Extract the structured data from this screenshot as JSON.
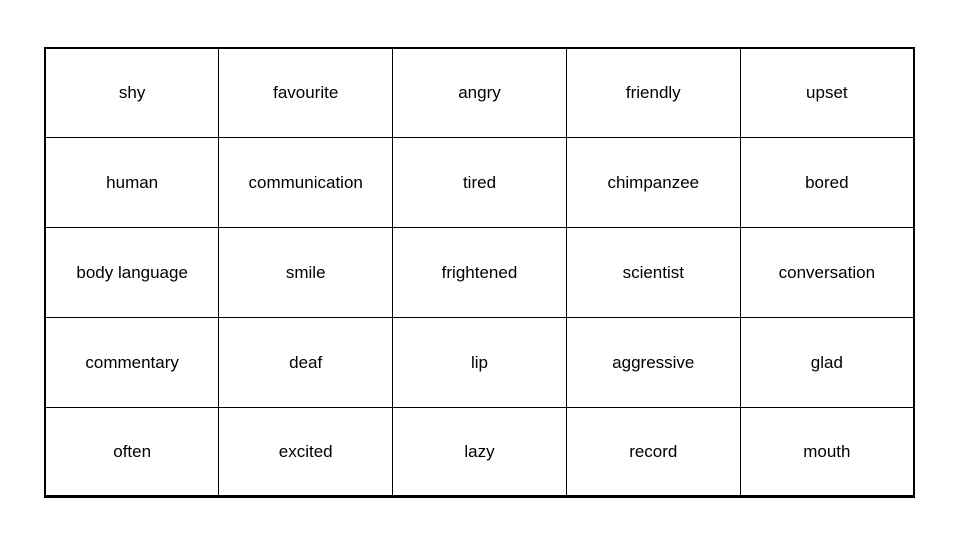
{
  "page": {
    "background_color": "#ffffff",
    "text_color": "#000000",
    "border_color": "#000000"
  },
  "grid": {
    "name": "vocabulary-word-grid",
    "columns": 5,
    "rows": 5,
    "cells": [
      [
        "shy",
        "favourite",
        "angry",
        "friendly",
        "upset"
      ],
      [
        "human",
        "communication",
        "tired",
        "chimpanzee",
        "bored"
      ],
      [
        "body language",
        "smile",
        "frightened",
        "scientist",
        "conversation"
      ],
      [
        "commentary",
        "deaf",
        "lip",
        "aggressive",
        "glad"
      ],
      [
        "often",
        "excited",
        "lazy",
        "record",
        "mouth"
      ]
    ]
  }
}
